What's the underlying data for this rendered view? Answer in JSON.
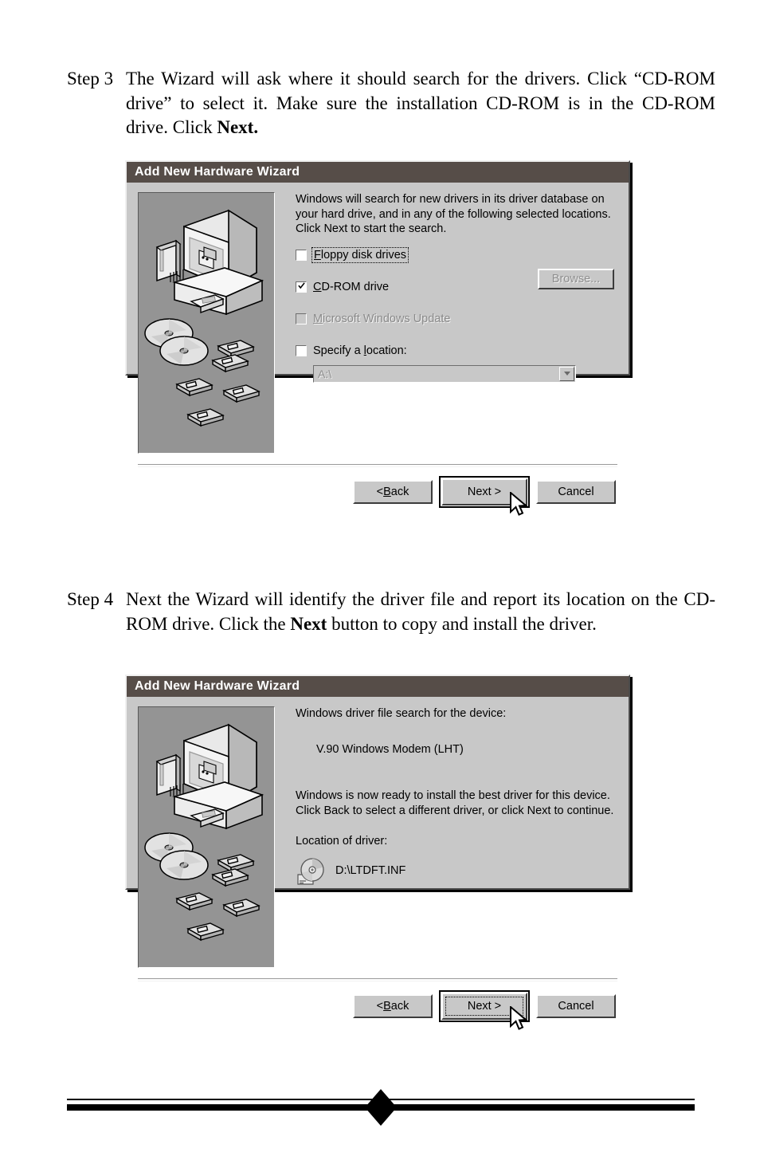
{
  "document": {
    "steps": [
      {
        "label": "Step 3",
        "text_html": "The Wizard will ask where it should search for the drivers. Click “CD-ROM drive” to select it. Make sure the installation CD-ROM is in the CD-ROM drive. Click <b>Next.</b>"
      },
      {
        "label": "Step 4",
        "text_html": "Next the Wizard will identify the driver file and report its location on the CD-ROM drive. Click the <b>Next</b> button to copy and install the driver."
      }
    ]
  },
  "colors": {
    "titlebar_bg": "#564d48",
    "titlebar_text": "#ffffff",
    "dialog_face": "#c8c8c8",
    "illustration_bg": "#949494",
    "disabled_text": "#8a8a8a",
    "page_bg": "#ffffff"
  },
  "dialog1": {
    "title": "Add New Hardware Wizard",
    "illustration_name": "computer-and-media-illustration",
    "intro_text": "Windows will search for new drivers in its driver database on your hard drive, and in any of the following selected locations. Click Next to start the search.",
    "checkboxes": [
      {
        "label": "Floppy disk drives",
        "accel": "F",
        "checked": false,
        "disabled": false,
        "focused": true
      },
      {
        "label": "CD-ROM drive",
        "accel": "C",
        "checked": true,
        "disabled": false,
        "focused": false
      },
      {
        "label": "Microsoft Windows Update",
        "accel": "M",
        "checked": false,
        "disabled": true,
        "focused": false
      },
      {
        "label": "Specify a location:",
        "accel": "l",
        "checked": false,
        "disabled": false,
        "focused": false
      }
    ],
    "location_combo": {
      "value": "A:\\",
      "disabled": true,
      "dropdown_icon": "chevron-down-icon"
    },
    "browse_button": {
      "label": "Browse...",
      "disabled": true
    },
    "buttons": [
      {
        "label": "< Back",
        "accel": "B",
        "default": false,
        "focused": false
      },
      {
        "label": "Next >",
        "default": true,
        "focused": false
      },
      {
        "label": "Cancel",
        "default": false,
        "focused": false
      }
    ],
    "cursor": "mouse-pointer"
  },
  "dialog2": {
    "title": "Add New Hardware Wizard",
    "illustration_name": "computer-and-media-illustration",
    "search_heading": "Windows driver file search for the device:",
    "device_name": "V.90 Windows Modem (LHT)",
    "ready_text": "Windows is now ready to install the best driver for this device. Click Back to select a different driver, or click Next to continue.",
    "location_heading": "Location of driver:",
    "driver_icon": "cd-drive-icon",
    "driver_path": "D:\\LTDFT.INF",
    "buttons": [
      {
        "label": "< Back",
        "accel": "B",
        "default": false,
        "focused": false
      },
      {
        "label": "Next >",
        "default": true,
        "focused": true
      },
      {
        "label": "Cancel",
        "default": false,
        "focused": false
      }
    ],
    "cursor": "mouse-pointer"
  },
  "footer": {
    "ornament": "diamond-rule-ornament"
  }
}
